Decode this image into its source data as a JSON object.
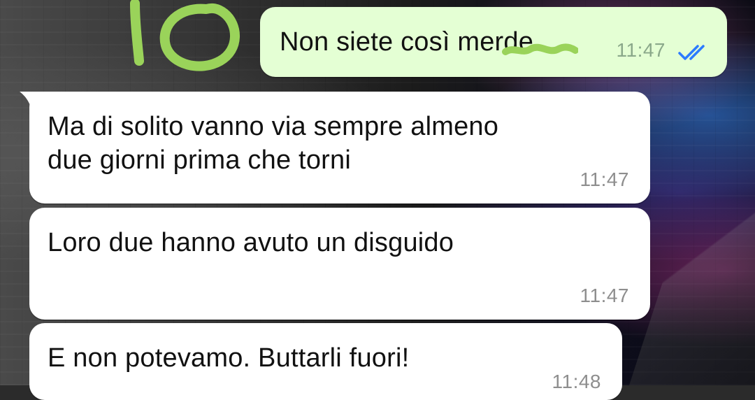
{
  "wallpaper": {
    "accent_colors": [
      "#3c8cff",
      "#ff6fd0",
      "#8a5cff",
      "#4a4a4a"
    ]
  },
  "doodle": {
    "text": "10",
    "color": "#9ad35a"
  },
  "conversation": {
    "messages": [
      {
        "direction": "outgoing",
        "text": "Non siete così merde",
        "time": "11:47",
        "status": "read",
        "status_icon": "double-check-icon",
        "status_color": "#2b7bff"
      },
      {
        "direction": "incoming",
        "text": "Ma di solito vanno via sempre almeno\ndue giorni prima che torni",
        "time": "11:47"
      },
      {
        "direction": "incoming",
        "text": "Loro due hanno avuto un disguido",
        "time": "11:47"
      },
      {
        "direction": "incoming",
        "text": "E non potevamo. Buttarli fuori!",
        "time": "11:48"
      }
    ]
  }
}
